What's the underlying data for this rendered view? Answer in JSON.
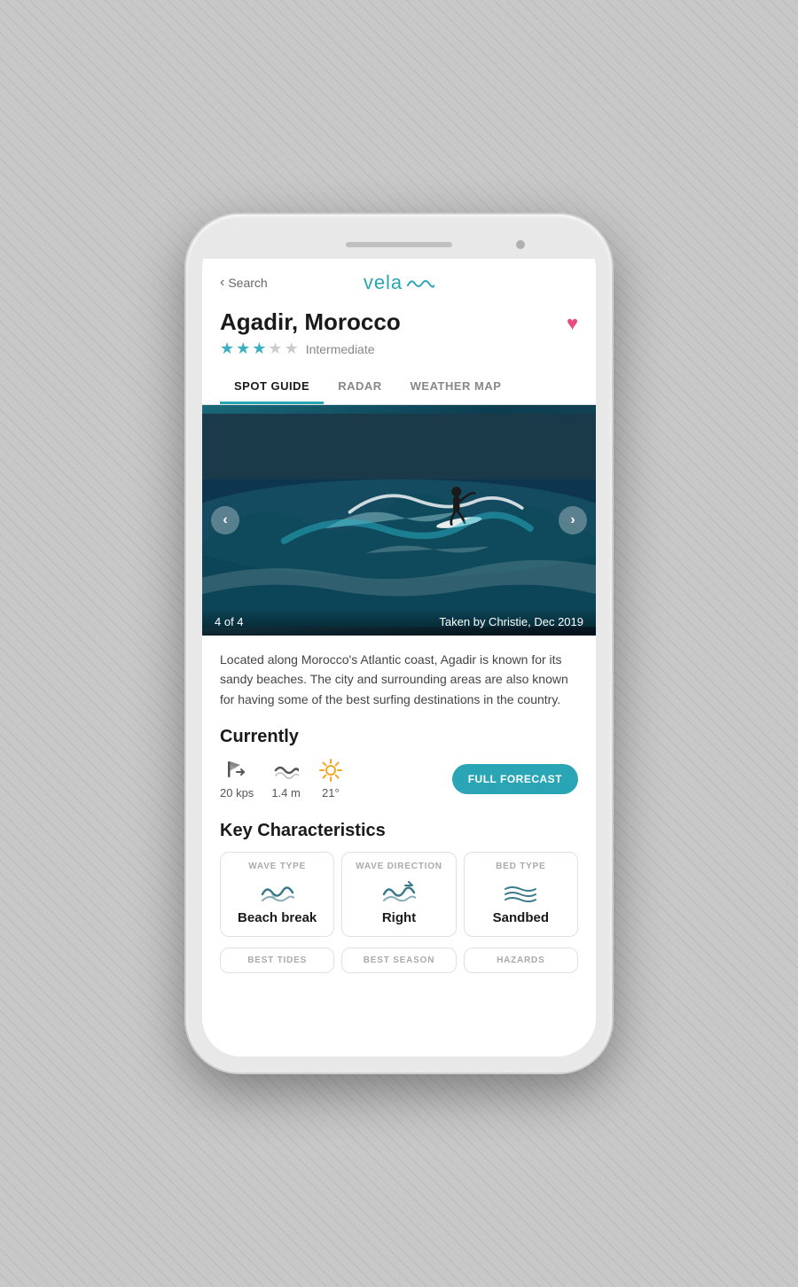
{
  "header": {
    "back_label": "Search",
    "logo_text": "vela",
    "logo_wave": "〜"
  },
  "location": {
    "title": "Agadir, Morocco",
    "skill_level": "Intermediate",
    "stars": 3,
    "max_stars": 5
  },
  "tabs": [
    {
      "id": "spot-guide",
      "label": "SPOT GUIDE",
      "active": true
    },
    {
      "id": "radar",
      "label": "RADAR",
      "active": false
    },
    {
      "id": "weather-map",
      "label": "WEATHER MAP",
      "active": false
    }
  ],
  "carousel": {
    "current": 4,
    "total": 4,
    "caption": "Taken by Christie, Dec 2019",
    "counter_text": "4 of 4"
  },
  "description": "Located along Morocco's Atlantic coast, Agadir is known for its sandy beaches. The city and surrounding areas are also known for having some of the best surfing destinations in the country.",
  "currently": {
    "title": "Currently",
    "wind_speed": "20 kps",
    "wave_height": "1.4 m",
    "temperature": "21°",
    "forecast_button": "FULL FORECAST"
  },
  "characteristics": {
    "title": "Key Characteristics",
    "items": [
      {
        "id": "wave-type",
        "label": "WAVE TYPE",
        "value": "Beach break"
      },
      {
        "id": "wave-direction",
        "label": "WAVE DIRECTION",
        "value": "Right"
      },
      {
        "id": "bed-type",
        "label": "BED TYPE",
        "value": "Sandbed"
      }
    ],
    "bottom_labels": [
      "BEST TIDES",
      "BEST SEASON",
      "HAZARDS"
    ]
  },
  "colors": {
    "accent": "#2aa5b5",
    "heart": "#e74c7c",
    "star": "#3bb0c5",
    "char_icon": "#3a7a8a"
  }
}
